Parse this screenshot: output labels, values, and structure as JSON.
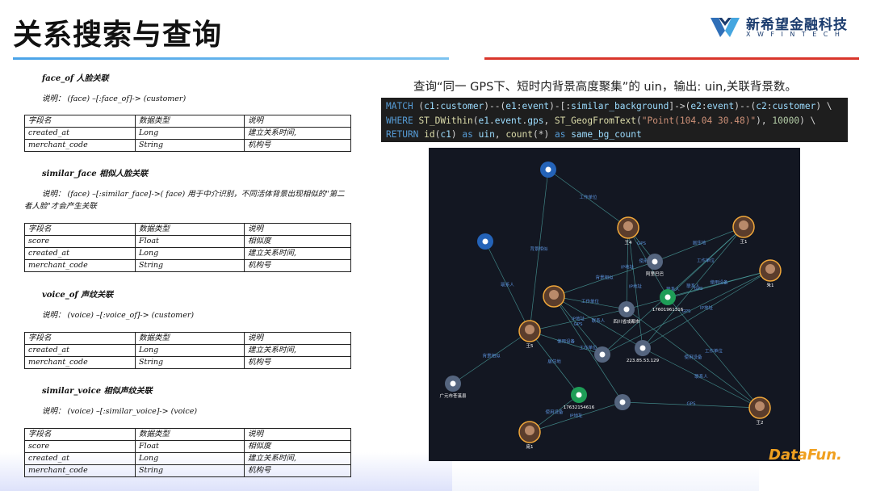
{
  "header": {
    "title": "关系搜索与查询",
    "logo_cn": "新希望金融科技",
    "logo_en": "XWFINTECH"
  },
  "doc": {
    "sections": [
      {
        "title": "face_of   人脸关联",
        "desc": "说明：  (face) –[:face_of]-> (customer)",
        "rows": [
          [
            "字段名",
            "数据类型",
            "说明"
          ],
          [
            "created_at",
            "Long",
            "建立关系时间,"
          ],
          [
            "merchant_code",
            "String",
            "机构号"
          ]
        ]
      },
      {
        "title": "similar_face   相似人脸关联",
        "desc": "说明：  (face) –[:similar_face]->( face)    用于中介识别，不同活体背景出现相似的\"第二者人脸\"才会产生关联",
        "rows": [
          [
            "字段名",
            "数据类型",
            "说明"
          ],
          [
            "score",
            "Float",
            "相似度"
          ],
          [
            "created_at",
            "Long",
            "建立关系时间,"
          ],
          [
            "merchant_code",
            "String",
            "机构号"
          ]
        ]
      },
      {
        "title": "voice_of   声纹关联",
        "desc": "说明：  (voice) –[:voice_of]-> (customer)",
        "rows": [
          [
            "字段名",
            "数据类型",
            "说明"
          ],
          [
            "created_at",
            "Long",
            "建立关系时间,"
          ],
          [
            "merchant_code",
            "String",
            "机构号"
          ]
        ]
      },
      {
        "title": "similar_voice   相似声纹关联",
        "desc": "说明：  (voice) –[:similar_voice]-> (voice)",
        "rows": [
          [
            "字段名",
            "数据类型",
            "说明"
          ],
          [
            "score",
            "Float",
            "相似度"
          ],
          [
            "created_at",
            "Long",
            "建立关系时间,"
          ],
          [
            "merchant_code",
            "String",
            "机构号"
          ]
        ]
      }
    ]
  },
  "query": {
    "description": "查询“同一 GPS下、短时内背景高度聚集”的 uin，输出: uin,关联背景数。",
    "code_lines": [
      "MATCH (c1:customer)--(e1:event)-[:similar_background]->(e2:event)--(c2:customer) \\",
      "WHERE ST_DWithin(e1.event.gps, ST_GeogFromText(\"Point(104.04 30.48)\"), 10000) \\",
      "RETURN id(c1) as uin, count(*) as same_bg_count"
    ]
  },
  "graph": {
    "node_labels": [
      "王1",
      "王4",
      "王5",
      "王2",
      "朱1",
      "庞1",
      "阿里巴巴",
      "四川省成都市",
      "17601961316",
      "223.85.53.129",
      "17632154616",
      "广元市苍溪县"
    ],
    "edge_labels": [
      "背景相似",
      "工作单位",
      "联系人",
      "GPS",
      "IP地址",
      "使用设备",
      "居住地",
      "工作单位",
      "联系人",
      "GPS",
      "使用设备",
      "IP地址"
    ]
  },
  "watermark": "DataFun."
}
